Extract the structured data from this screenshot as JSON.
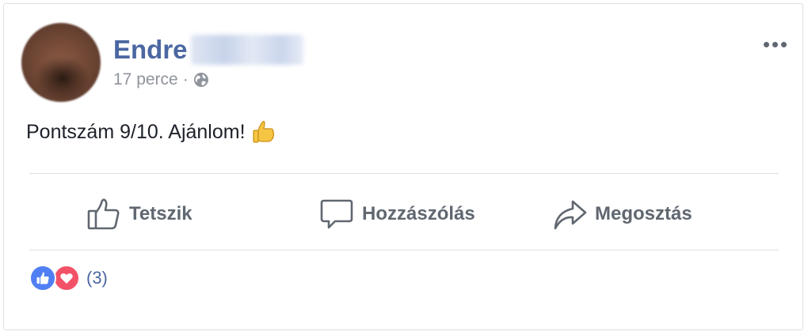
{
  "post": {
    "author_first": "Endre",
    "timestamp": "17 perce",
    "separator": "·",
    "privacy_icon": "globe-icon",
    "text": "Pontszám 9/10. Ajánlom!",
    "emoji": "thumbs-up-emoji"
  },
  "actions": {
    "like_label": "Tetszik",
    "comment_label": "Hozzászólás",
    "share_label": "Megosztás"
  },
  "reactions": {
    "count": "(3)",
    "types": [
      "like",
      "love"
    ]
  },
  "colors": {
    "name": "#4b67a1",
    "meta": "#90949c",
    "action": "#606770",
    "like": "#4f7ff3",
    "love": "#f25268"
  }
}
